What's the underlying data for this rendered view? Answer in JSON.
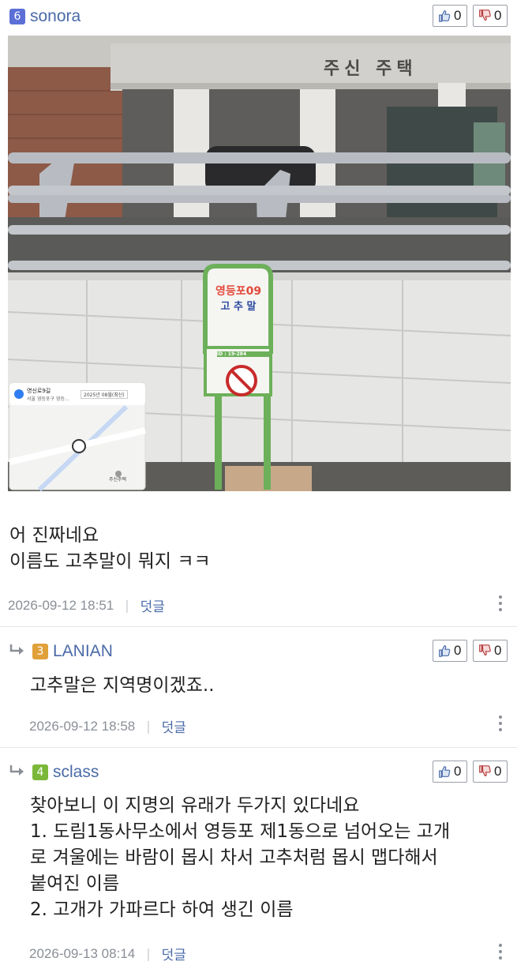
{
  "post": {
    "level": "6",
    "level_color": "#5b6fd6",
    "username": "sonora",
    "likes": "0",
    "dislikes": "0",
    "photo": {
      "building_sign": "주신 주택",
      "bus_stop_number": "영등포09",
      "bus_stop_name": "고 추 말",
      "bus_stop_id": "ID : 19-284",
      "map_place": "영신로9길",
      "map_address": "서울 영등포구 영등...",
      "map_date": "2025년 08월(최신)",
      "map_landmark": "주신주택"
    },
    "lines": [
      "어 진짜네요",
      "이름도 고추말이 뭐지 ㅋㅋ"
    ],
    "date": "2026-09-12 18:51",
    "reply_label": "덧글"
  },
  "comments": [
    {
      "level": "3",
      "level_color": "#e0a13a",
      "username": "LANIAN",
      "likes": "0",
      "dislikes": "0",
      "lines": [
        "고추말은 지역명이겠죠.."
      ],
      "date": "2026-09-12 18:58",
      "reply_label": "덧글"
    },
    {
      "level": "4",
      "level_color": "#7bb83a",
      "username": "sclass",
      "likes": "0",
      "dislikes": "0",
      "lines": [
        "찾아보니 이 지명의 유래가 두가지 있다네요",
        "1. 도림1동사무소에서 영등포 제1동으로 넘어오는 고개",
        "로 겨울에는 바람이 몹시 차서 고추처럼 몹시 맵다해서",
        "붙여진 이름",
        "2. 고개가 가파르다 하여 생긴 이름"
      ],
      "date": "2026-09-13 08:14",
      "reply_label": "덧글"
    }
  ],
  "icons": {
    "like": "thumbs-up-icon",
    "dislike": "thumbs-down-icon",
    "reply": "reply-arrow-icon",
    "more": "kebab-menu-icon",
    "location": "map-pin-icon"
  }
}
